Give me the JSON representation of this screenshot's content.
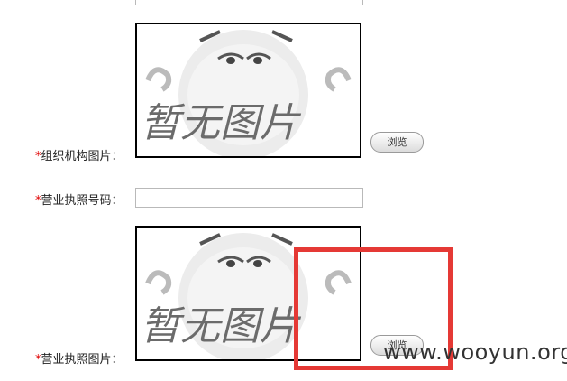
{
  "fields": {
    "org_image": {
      "label": "组织机构图片：",
      "required_mark": "*",
      "browse_label": "浏览",
      "placeholder_text": "暂无图片"
    },
    "license_number": {
      "label": "营业执照号码：",
      "required_mark": "*",
      "value": ""
    },
    "license_image": {
      "label": "营业执照图片：",
      "required_mark": "*",
      "browse_label": "浏览",
      "placeholder_text": "暂无图片"
    }
  },
  "watermark": "www.wooyun.org",
  "colors": {
    "required": "#e00000",
    "highlight": "#e53935"
  }
}
